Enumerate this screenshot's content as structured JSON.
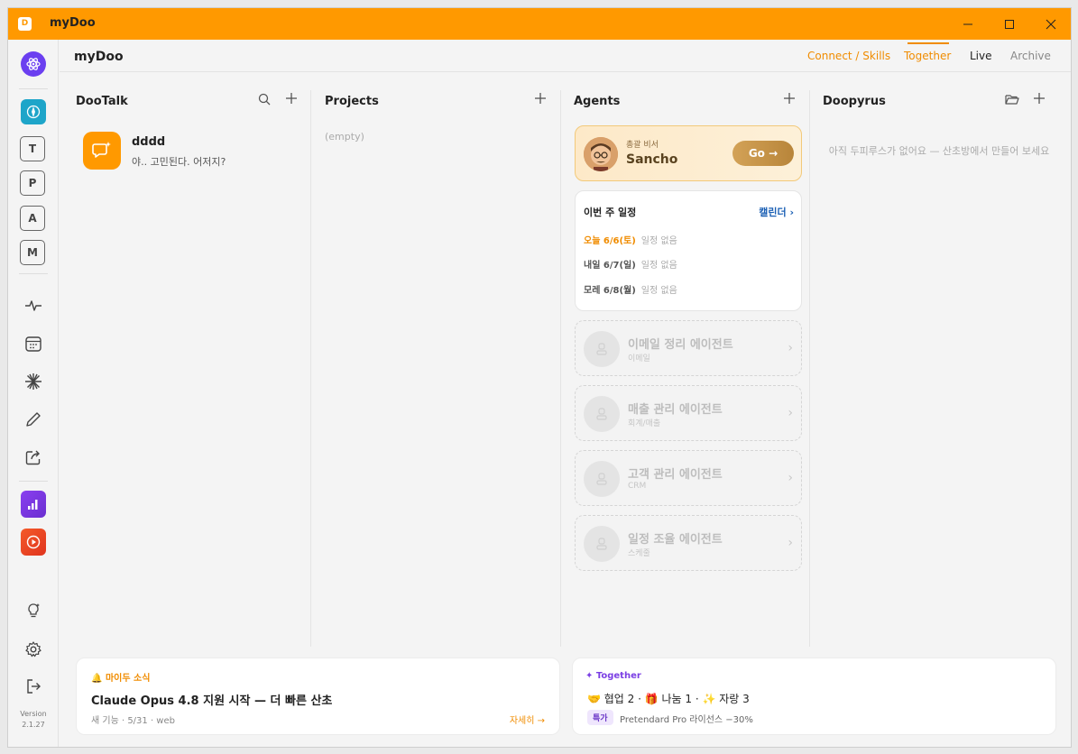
{
  "window": {
    "title": "myDoo",
    "app_icon_letter": "D"
  },
  "sidebar": {
    "letters": [
      "T",
      "P",
      "A",
      "M"
    ],
    "version_label": "Version",
    "version_number": "2.1.27"
  },
  "topbar": {
    "brand": "myDoo",
    "tabs": [
      "Connect / Skills",
      "Together",
      "Live",
      "Archive"
    ],
    "active_tab": "Live"
  },
  "dootalk": {
    "title": "DooTalk",
    "chats": [
      {
        "name": "dddd",
        "message": "야.. 고민된다. 어저지?"
      }
    ]
  },
  "projects": {
    "title": "Projects",
    "empty": "(empty)"
  },
  "agents": {
    "title": "Agents",
    "featured": {
      "role": "총괄 비서",
      "name": "Sancho",
      "button": "Go →"
    },
    "schedule": {
      "title": "이번 주 일정",
      "link": "캘린더 ›",
      "rows": [
        {
          "day": "오늘 6/6(토)",
          "status": "일정 없음"
        },
        {
          "day": "내일 6/7(일)",
          "status": "일정 없음"
        },
        {
          "day": "모레 6/8(월)",
          "status": "일정 없음"
        }
      ]
    },
    "list": [
      {
        "name": "이메일 정리 에이전트",
        "sub": "이메일"
      },
      {
        "name": "매출 관리 에이전트",
        "sub": "회계/매출"
      },
      {
        "name": "고객 관리 에이전트",
        "sub": "CRM"
      },
      {
        "name": "일정 조율 에이전트",
        "sub": "스케줄"
      }
    ]
  },
  "doopyrus": {
    "title": "Doopyrus",
    "empty": "아직 두피루스가 없어요 — 산초방에서 만들어 보세요"
  },
  "news": {
    "tag": "마이두 소식",
    "title": "Claude Opus 4.8 지원 시작 — 더 빠른 산초",
    "meta": "새 기능 · 5/31 · web",
    "more": "자세히 →"
  },
  "together_card": {
    "tag": "✦ Together",
    "stats": "🤝 협업 2 · 🎁 나눔 1 · ✨ 자랑 3",
    "badge": "특가",
    "promo": "Pretendard Pro 라이선스 −30%"
  },
  "colors": {
    "accent": "#ff9900",
    "purple": "#7b3fe4"
  }
}
